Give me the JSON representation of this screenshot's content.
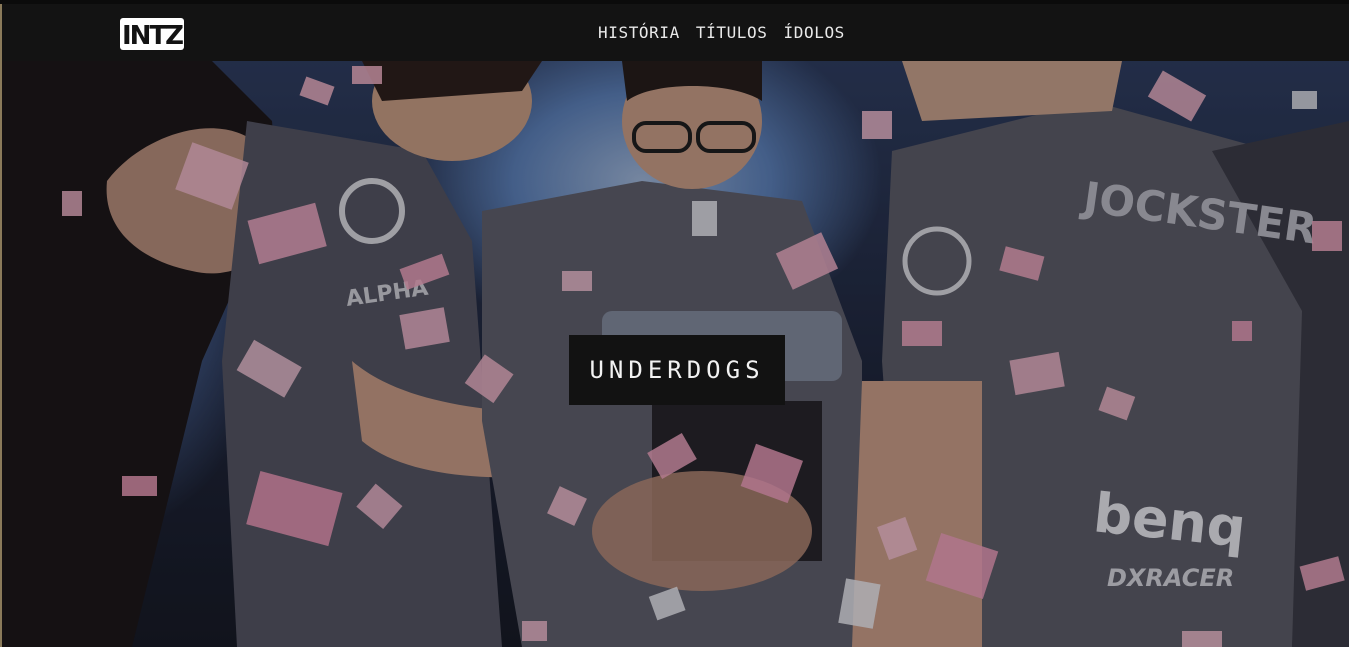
{
  "brand": {
    "logo_text": "INTZ"
  },
  "nav": {
    "items": [
      {
        "label": "HISTÓRIA"
      },
      {
        "label": "TÍTULOS"
      },
      {
        "label": "ÍDOLOS"
      }
    ]
  },
  "hero": {
    "title": "UNDERDOGS",
    "jersey_text": {
      "name": "JOCKSTER",
      "sponsor_left": "ALPHA",
      "sponsor_right": "benq",
      "sponsor_bottom": "DXRACER"
    }
  },
  "colors": {
    "navbar_bg": "#131313",
    "nav_text": "#e9e9e9",
    "title_box_bg": "#121212",
    "title_text": "#f2f2f2"
  }
}
